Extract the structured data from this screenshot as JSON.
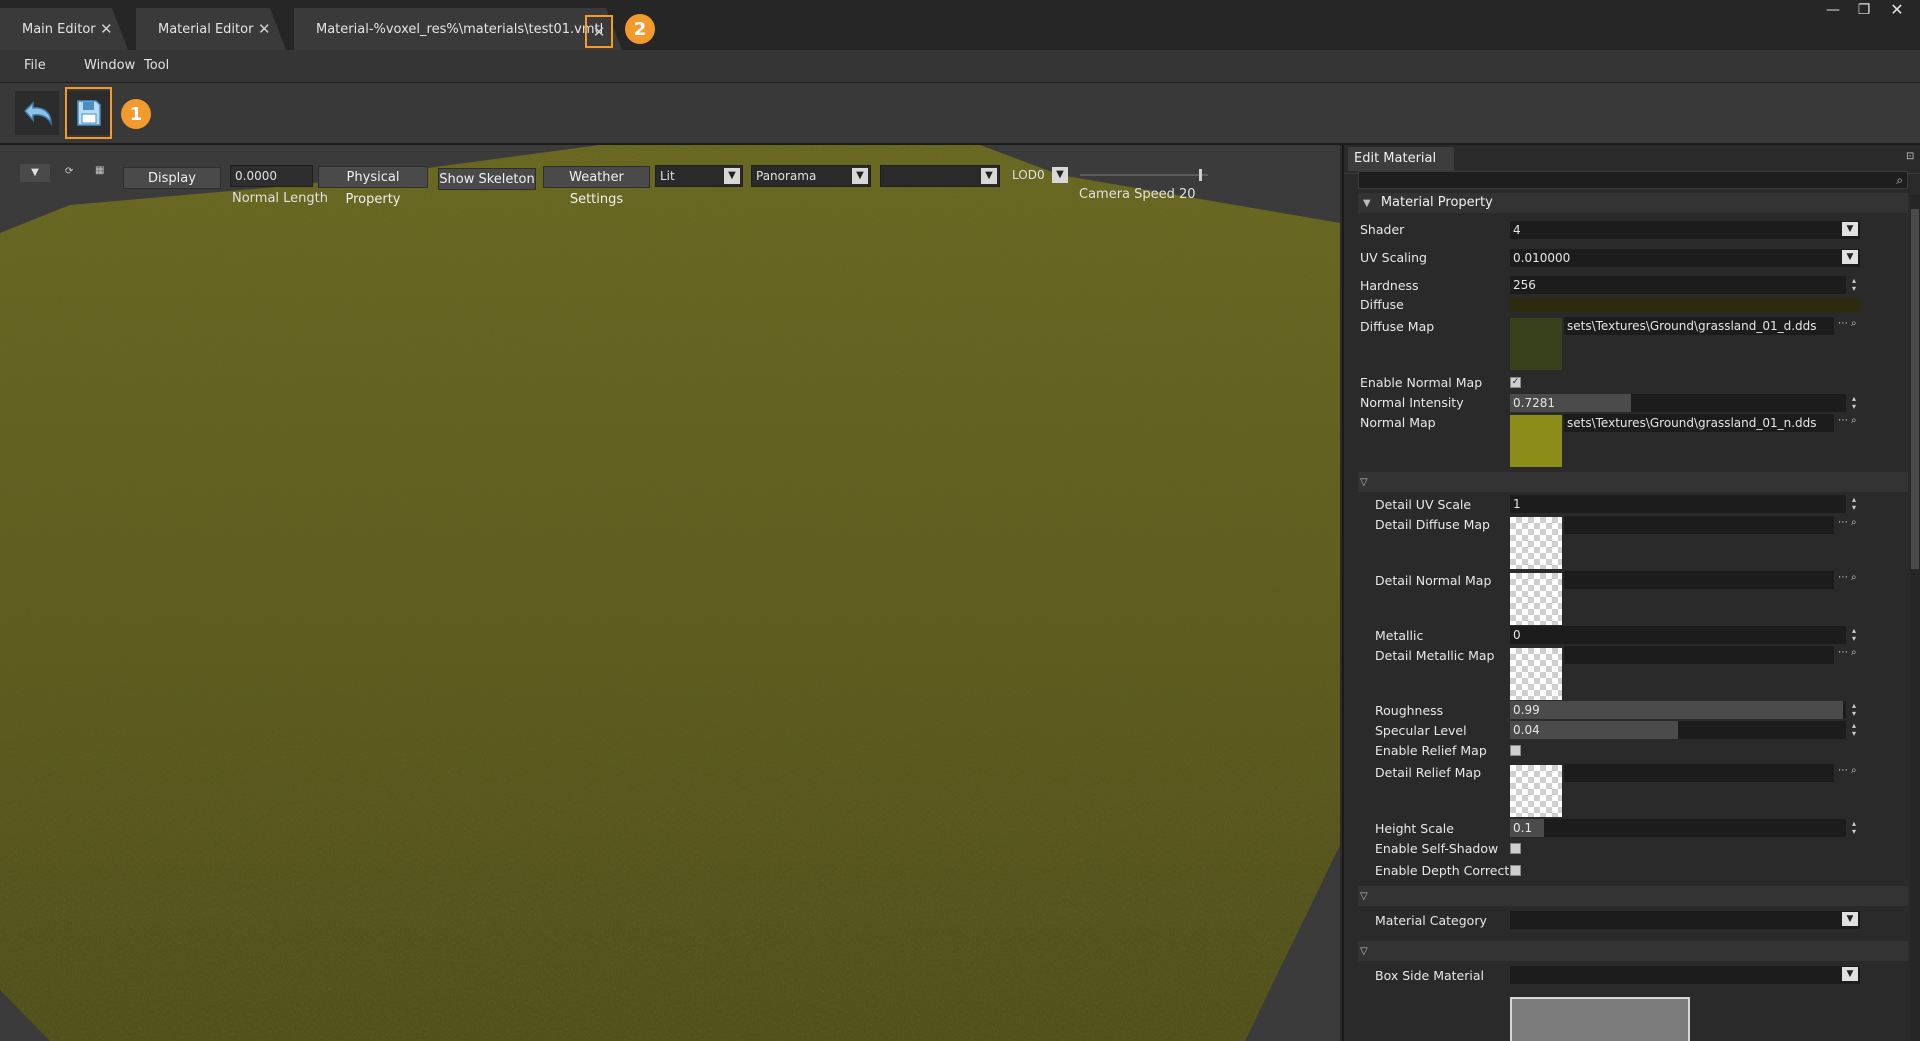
{
  "tabs": [
    {
      "label": "Main Editor"
    },
    {
      "label": "Material Editor"
    },
    {
      "label": "Material-%voxel_res%\\materials\\test01.vmtl"
    }
  ],
  "annotations": {
    "badge1": "1",
    "badge2": "2"
  },
  "menu": {
    "file": "File",
    "window": "Window",
    "tool": "Tool"
  },
  "viewport_toolbar": {
    "display": "Display",
    "normal_length_value": "0.0000",
    "normal_length_label": "Normal Length",
    "physical_property": "Physical Property",
    "show_skeleton": "Show Skeleton",
    "weather_settings": "Weather Settings",
    "lighting_select": "Lit",
    "background_select": "Panorama",
    "empty_select": "",
    "lod_select": "LOD0",
    "camera_speed_label": "Camera Speed 20",
    "camera_speed_level": 0.95
  },
  "panel": {
    "tab": "Edit Material",
    "search_placeholder": "",
    "section_material_property": "Material Property",
    "shader_label": "Shader",
    "shader_value": "4",
    "uv_scaling_label": "UV Scaling",
    "uv_scaling_value": "0.010000",
    "hardness_label": "Hardness",
    "hardness_value": "256",
    "diffuse_label": "Diffuse",
    "diffuse_color": "#2d2a0e",
    "diffuse_map_label": "Diffuse Map",
    "diffuse_map_path": "sets\\Textures\\Ground\\grassland_01_d.dds",
    "enable_normal_map_label": "Enable Normal Map",
    "enable_normal_map_checked": true,
    "normal_intensity_label": "Normal Intensity",
    "normal_intensity_value": "0.7281",
    "normal_intensity_fill": 0.36,
    "normal_map_label": "Normal Map",
    "normal_map_path": "sets\\Textures\\Ground\\grassland_01_n.dds",
    "detail_uv_scale_label": "Detail UV Scale",
    "detail_uv_scale_value": "1",
    "detail_diffuse_map_label": "Detail Diffuse Map",
    "detail_normal_map_label": "Detail Normal Map",
    "metallic_label": "Metallic",
    "metallic_value": "0",
    "detail_metallic_map_label": "Detail Metallic Map",
    "roughness_label": "Roughness",
    "roughness_value": "0.99",
    "roughness_fill": 0.99,
    "specular_level_label": "Specular Level",
    "specular_level_value": "0.04",
    "specular_level_fill": 0.5,
    "enable_relief_map_label": "Enable Relief Map",
    "enable_relief_map_checked": false,
    "detail_relief_map_label": "Detail Relief Map",
    "height_scale_label": "Height Scale",
    "height_scale_value": "0.1",
    "height_scale_fill": 0.1,
    "enable_self_shadow_label": "Enable Self-Shadow",
    "enable_self_shadow_checked": false,
    "enable_depth_correct_label": "Enable Depth Correct",
    "enable_depth_correct_checked": false,
    "material_category_label": "Material Category",
    "material_category_value": "",
    "box_side_material_label": "Box Side Material",
    "box_side_material_value": ""
  },
  "colors": {
    "accent": "#f29a2e",
    "grass": "#6b6a22"
  }
}
